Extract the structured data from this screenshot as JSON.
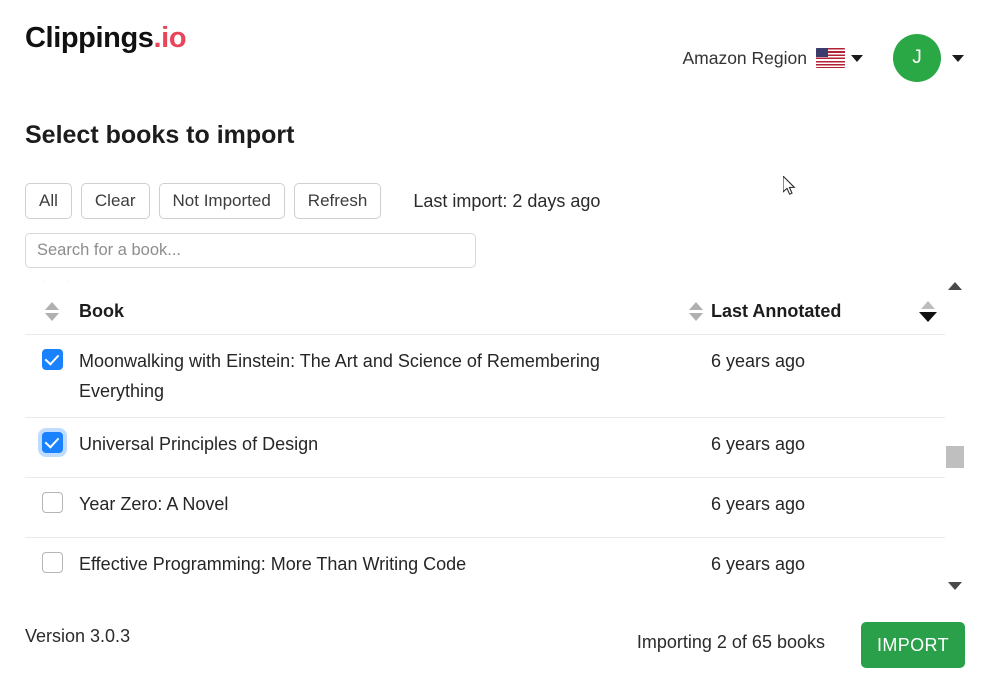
{
  "header": {
    "logo_main": "Clippings",
    "logo_suffix": ".io",
    "region_label": "Amazon Region",
    "flag_icon": "us-flag-icon",
    "region_caret_icon": "chevron-down-icon",
    "avatar_initial": "J",
    "avatar_color": "#2aa845",
    "avatar_caret_icon": "chevron-down-icon"
  },
  "page": {
    "title": "Select books to import"
  },
  "toolbar": {
    "buttons": [
      {
        "label": "All",
        "name": "select-all-button"
      },
      {
        "label": "Clear",
        "name": "clear-selection-button"
      },
      {
        "label": "Not Imported",
        "name": "not-imported-filter-button"
      },
      {
        "label": "Refresh",
        "name": "refresh-button"
      }
    ],
    "last_import": "Last import: 2 days ago"
  },
  "search": {
    "placeholder": "Search for a book...",
    "value": ""
  },
  "table": {
    "headers": {
      "book": "Book",
      "last_annotated": "Last Annotated"
    },
    "sort": {
      "book_sort_icon": "sort-both-icon",
      "middle_sort_icon": "sort-both-icon",
      "annotated_sort_icon": "sort-descending-icon",
      "active_direction": "descending"
    },
    "rows": [
      {
        "checked": true,
        "focused": false,
        "title": "Moonwalking with Einstein: The Art and Science of Remembering Everything",
        "last_annotated": "6 years ago"
      },
      {
        "checked": true,
        "focused": true,
        "title": "Universal Principles of Design",
        "last_annotated": "6 years ago"
      },
      {
        "checked": false,
        "focused": false,
        "title": "Year Zero: A Novel",
        "last_annotated": "6 years ago"
      },
      {
        "checked": false,
        "focused": false,
        "title": "Effective Programming: More Than Writing Code",
        "last_annotated": "6 years ago"
      }
    ]
  },
  "scrollbar": {
    "up_icon": "scroll-up-arrow-icon",
    "down_icon": "scroll-down-arrow-icon"
  },
  "footer": {
    "version": "Version 3.0.3",
    "status": "Importing 2 of 65 books",
    "import_label": "IMPORT",
    "import_color": "#2ba04a"
  },
  "cursor": {
    "icon": "mouse-pointer-icon"
  }
}
